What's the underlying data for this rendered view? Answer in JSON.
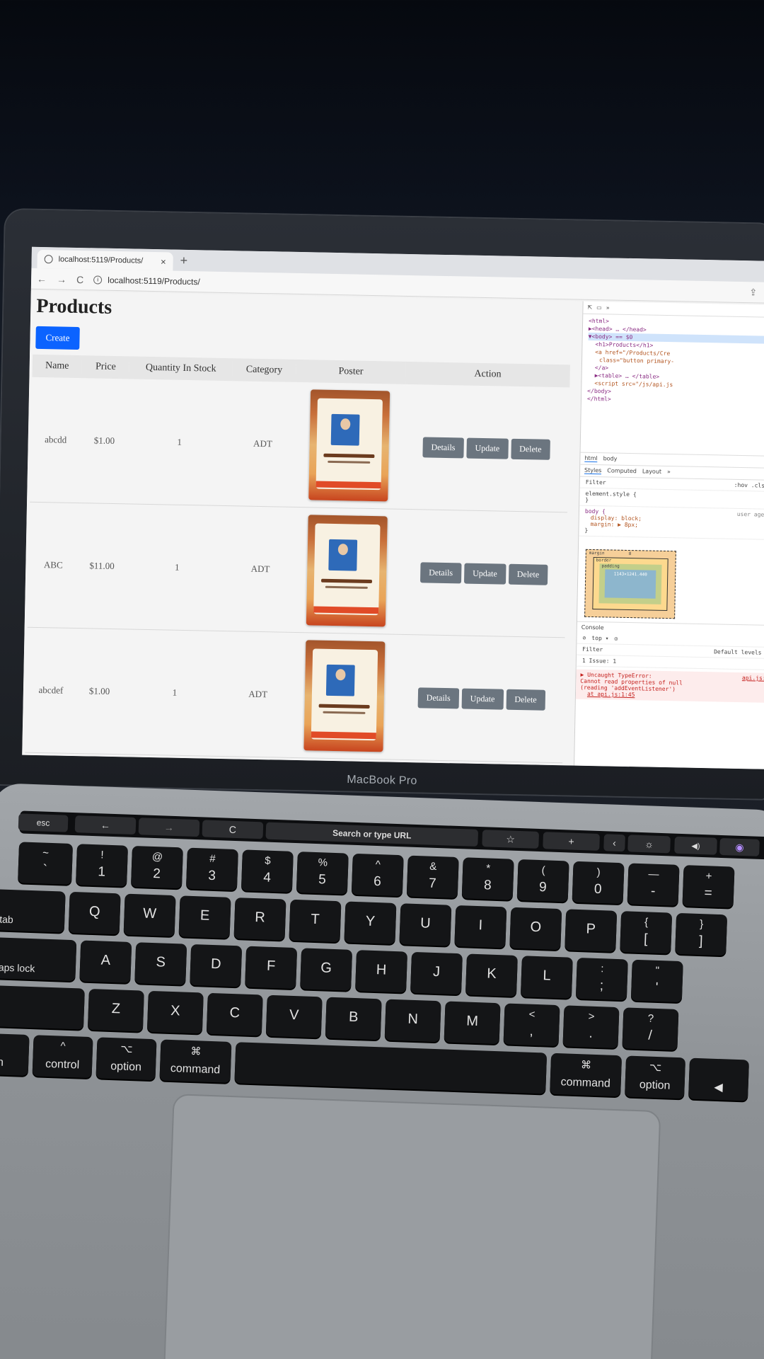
{
  "browser": {
    "tab_title": "localhost:5119/Products/",
    "tab_close": "×",
    "new_tab": "+",
    "url": "localhost:5119/Products/",
    "nav_back": "←",
    "nav_forward": "→",
    "nav_reload": "C"
  },
  "page": {
    "title": "Products",
    "create_label": "Create",
    "columns": [
      "Name",
      "Price",
      "Quantity In Stock",
      "Category",
      "Poster",
      "Action"
    ],
    "rows": [
      {
        "name": "abcdd",
        "price": "$1.00",
        "qty": "1",
        "category": "ADT"
      },
      {
        "name": "ABC",
        "price": "$11.00",
        "qty": "1",
        "category": "ADT"
      },
      {
        "name": "abcdef",
        "price": "$1.00",
        "qty": "1",
        "category": "ADT"
      }
    ],
    "actions": {
      "details": "Details",
      "update": "Update",
      "delete": "Delete"
    }
  },
  "devtools": {
    "elements_lines": [
      "<html>",
      "▶<head> … </head>",
      "▼<body> == $0",
      "<h1>Products</h1>",
      "<a href=\"/Products/Cre",
      "class=\"button primary-",
      "</a>",
      "▶<table> … </table>",
      "<script src=\"/js/api.js",
      "</body>",
      "</html>"
    ],
    "breadcrumb": [
      "html",
      "body"
    ],
    "panel_tabs": [
      "Styles",
      "Computed",
      "Layout",
      "»"
    ],
    "filter_placeholder": "Filter",
    "filter_hints": ":hov .cls +",
    "style_rules": [
      "element.style {",
      "}",
      "body {",
      "display: block;",
      "margin: ▶ 8px;",
      "}"
    ],
    "user_agent": "user agent",
    "box_labels": {
      "margin": "margin",
      "border": "border",
      "padding": "padding",
      "content": "1143×1241.440",
      "margin_value": "8"
    },
    "console_title": "Console",
    "console_context": "top ▾",
    "console_filter": "Filter",
    "console_levels": "Default levels ▾",
    "issues": "1 Issue: 1",
    "error_lines": [
      "▶ Uncaught TypeError:",
      "Cannot read properties of null",
      "(reading 'addEventListener')",
      "at api.js:1:45"
    ],
    "error_source": "api.js:1"
  },
  "laptop": {
    "brand": "MacBook Pro",
    "touchbar": {
      "esc": "esc",
      "back": "←",
      "forward": "→",
      "reload": "C",
      "search": "Search or type URL",
      "star": "☆",
      "plus": "+",
      "chevron": "‹",
      "brightness": "☼",
      "volume": "◀)",
      "siri": "◉"
    },
    "row1": [
      [
        "~",
        "`"
      ],
      [
        "!",
        "1"
      ],
      [
        "@",
        "2"
      ],
      [
        "#",
        "3"
      ],
      [
        "$",
        "4"
      ],
      [
        "%",
        "5"
      ],
      [
        "^",
        "6"
      ],
      [
        "&",
        "7"
      ],
      [
        "*",
        "8"
      ],
      [
        "(",
        "9"
      ],
      [
        ")",
        "0"
      ],
      [
        "—",
        "-"
      ],
      [
        "+",
        "="
      ]
    ],
    "row2": [
      "tab",
      "Q",
      "W",
      "E",
      "R",
      "T",
      "Y",
      "U",
      "I",
      "O",
      "P",
      [
        "{",
        "["
      ],
      [
        "}",
        "]"
      ]
    ],
    "row3": [
      "caps lock",
      "A",
      "S",
      "D",
      "F",
      "G",
      "H",
      "J",
      "K",
      "L",
      [
        ":",
        ";"
      ],
      [
        "\"",
        "'"
      ]
    ],
    "row4": [
      "ft",
      "Z",
      "X",
      "C",
      "V",
      "B",
      "N",
      "M",
      [
        "<",
        ","
      ],
      [
        ">",
        "."
      ],
      [
        "?",
        "/"
      ]
    ],
    "row5": [
      [
        "",
        "fn"
      ],
      [
        "^",
        "control"
      ],
      [
        "⌥",
        "option"
      ],
      [
        "⌘",
        "command"
      ],
      [
        "",
        ""
      ],
      [
        "⌘",
        "command"
      ],
      [
        "⌥",
        "option"
      ],
      [
        "",
        "◀"
      ]
    ]
  }
}
